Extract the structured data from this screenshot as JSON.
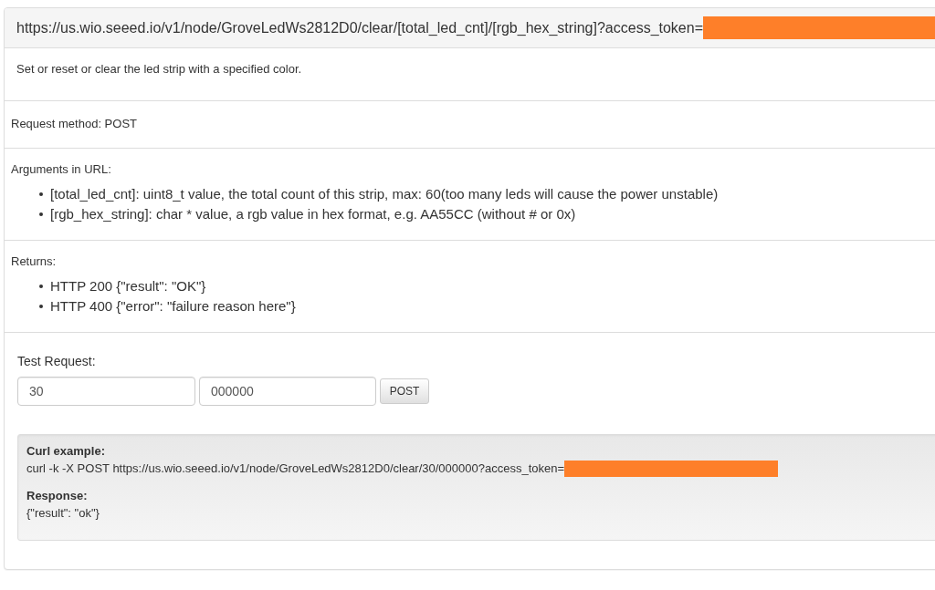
{
  "endpoint": {
    "url": "https://us.wio.seeed.io/v1/node/GroveLedWs2812D0/clear/[total_led_cnt]/[rgb_hex_string]?access_token=",
    "token_redacted": true
  },
  "description": "Set or reset or clear the led strip with a specified color.",
  "request_method": "Request method: POST",
  "arguments": {
    "heading": "Arguments in URL:",
    "items": [
      "[total_led_cnt]: uint8_t value, the total count of this strip, max: 60(too many leds will cause the power unstable)",
      "[rgb_hex_string]: char * value, a rgb value in hex format, e.g. AA55CC (without # or 0x)"
    ]
  },
  "returns": {
    "heading": "Returns:",
    "items": [
      "HTTP 200 {\"result\": \"OK\"}",
      "HTTP 400 {\"error\": \"failure reason here\"}"
    ]
  },
  "test_request": {
    "label": "Test Request:",
    "inputs": [
      {
        "value": "30"
      },
      {
        "value": "000000"
      }
    ],
    "button": "POST"
  },
  "curl_example": {
    "heading": "Curl example:",
    "command": "curl -k -X POST https://us.wio.seeed.io/v1/node/GroveLedWs2812D0/clear/30/000000?access_token=",
    "token_redacted": true,
    "response_heading": "Response:",
    "response": "{\"result\": \"ok\"}"
  }
}
